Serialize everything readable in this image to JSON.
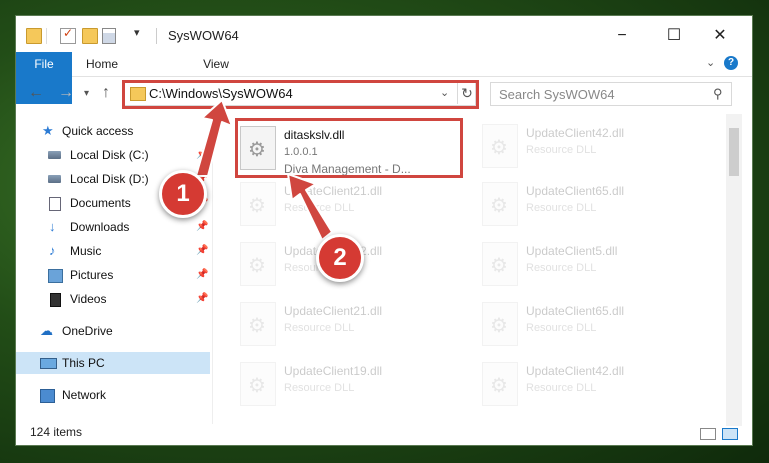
{
  "window": {
    "title": "SysWOW64"
  },
  "ribbon": {
    "tabs": [
      "File",
      "Home",
      "View"
    ],
    "help": "?"
  },
  "address": {
    "path": "C:\\Windows\\SysWOW64"
  },
  "search": {
    "placeholder": "Search SysWOW64"
  },
  "nav": {
    "items": [
      {
        "label": "Quick access"
      },
      {
        "label": "Local Disk (C:)"
      },
      {
        "label": "Local Disk (D:)"
      },
      {
        "label": "Documents"
      },
      {
        "label": "Downloads"
      },
      {
        "label": "Music"
      },
      {
        "label": "Pictures"
      },
      {
        "label": "Videos"
      },
      {
        "label": "OneDrive"
      },
      {
        "label": "This PC"
      },
      {
        "label": "Network"
      }
    ]
  },
  "files": {
    "selected": {
      "name": "ditaskslv.dll",
      "version": "1.0.0.1",
      "company": "Diva Management - D..."
    },
    "others": [
      {
        "name": "UpdateClient42.dll",
        "desc": "Resource DLL"
      },
      {
        "name": "UpdateClient21.dll",
        "desc": "Resource DLL"
      },
      {
        "name": "UpdateClient65.dll",
        "desc": "Resource DLL"
      },
      {
        "name": "UpdateClient42.dll",
        "desc": "Resource DLL"
      },
      {
        "name": "UpdateClient5.dll",
        "desc": "Resource DLL"
      },
      {
        "name": "UpdateClient21.dll",
        "desc": "Resource DLL"
      },
      {
        "name": "UpdateClient65.dll",
        "desc": "Resource DLL"
      },
      {
        "name": "UpdateClient19.dll",
        "desc": "Resource DLL"
      },
      {
        "name": "UpdateClient42.dll",
        "desc": "Resource DLL"
      }
    ]
  },
  "status": {
    "count": "124 items"
  },
  "annotations": {
    "step1": "1",
    "step2": "2",
    "color": "#d0463f"
  }
}
